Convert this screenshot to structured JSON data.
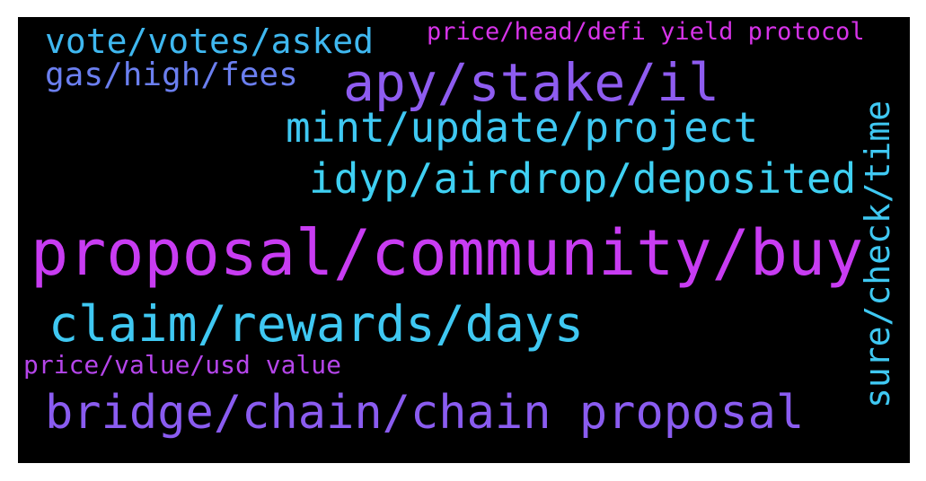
{
  "words": [
    {
      "text": "price/head/defi yield protocol",
      "color": "#d633e8"
    },
    {
      "text": "vote/votes/asked",
      "color": "#3fb8f0"
    },
    {
      "text": "apy/stake/il",
      "color": "#8e5cf0"
    },
    {
      "text": "gas/high/fees",
      "color": "#6b7ff0"
    },
    {
      "text": "mint/update/project",
      "color": "#3fc8f2"
    },
    {
      "text": "idyp/airdrop/deposited",
      "color": "#3fd0f2"
    },
    {
      "text": "sure/check/time",
      "color": "#3fc8f2"
    },
    {
      "text": "proposal/community/buy",
      "color": "#c83cf2"
    },
    {
      "text": "claim/rewards/days",
      "color": "#3fc8f2"
    },
    {
      "text": "price/value/usd value",
      "color": "#b545ea"
    },
    {
      "text": "bridge/chain/chain proposal",
      "color": "#8a5cf0"
    }
  ]
}
